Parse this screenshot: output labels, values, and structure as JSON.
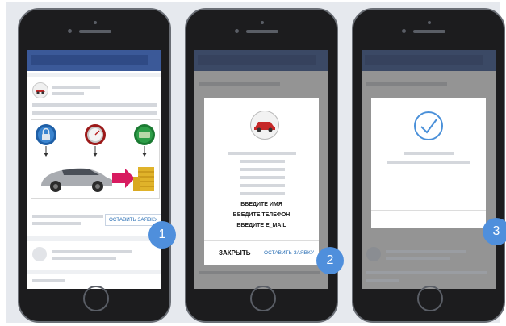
{
  "phones": [
    {
      "id": 1,
      "badge": "1",
      "send_button": "ОСТАВИТЬ ЗАЯВКУ"
    },
    {
      "id": 2,
      "badge": "2",
      "prompts": [
        "ВВЕДИТЕ ИМЯ",
        "ВВЕДИТЕ ТЕЛЕФОН",
        "ВВЕДИТЕ E_MAIL"
      ],
      "close_button": "ЗАКРЫТЬ",
      "send_button": "ОСТАВИТЬ ЗАЯВКУ"
    },
    {
      "id": 3,
      "badge": "3"
    }
  ],
  "colors": {
    "header": "#3b5998",
    "badge": "#4f8fdc",
    "link": "#2a6fb5",
    "check": "#4a90d9"
  },
  "icons": [
    "lock-icon",
    "speedometer-icon",
    "money-icon",
    "car-icon",
    "checkmark-icon"
  ]
}
